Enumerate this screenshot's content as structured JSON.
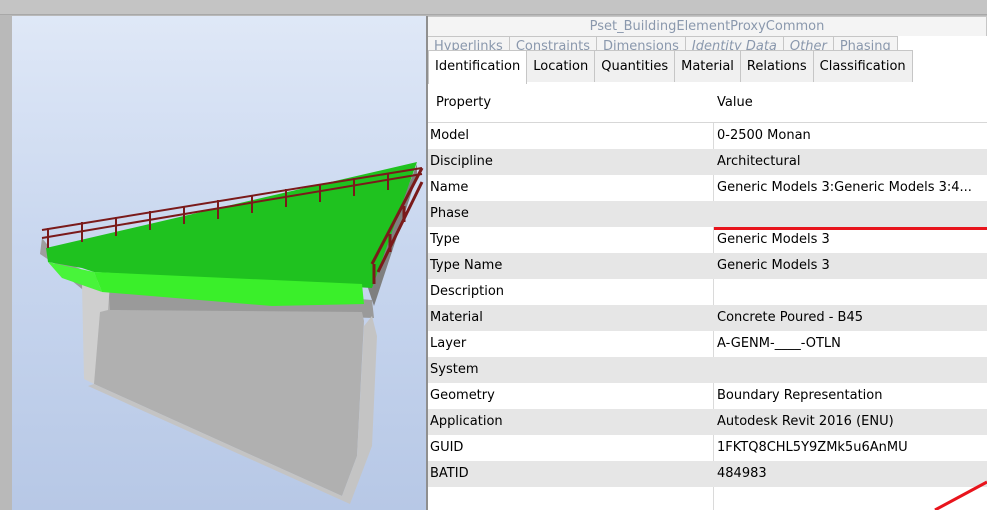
{
  "colors": {
    "accent_red": "#e8141c",
    "slab_green": "#1fc21f",
    "rail_maroon": "#7a1a1a"
  },
  "tabs": {
    "row_top": [
      "Pset_BuildingElementProxyCommon"
    ],
    "row_mid": [
      "Hyperlinks",
      "Constraints",
      "Dimensions",
      "Identity Data",
      "Other",
      "Phasing"
    ],
    "row_main": [
      "Identification",
      "Location",
      "Quantities",
      "Material",
      "Relations",
      "Classification"
    ],
    "active": "Identification"
  },
  "grid": {
    "headers": {
      "property": "Property",
      "value": "Value"
    },
    "rows": [
      {
        "property": "Model",
        "value": "0-2500 Monan"
      },
      {
        "property": "Discipline",
        "value": "Architectural"
      },
      {
        "property": "Name",
        "value": "Generic Models 3:Generic Models 3:4..."
      },
      {
        "property": "Phase",
        "value": ""
      },
      {
        "property": "Type",
        "value": "Generic Models 3"
      },
      {
        "property": "Type Name",
        "value": "Generic Models 3"
      },
      {
        "property": "Description",
        "value": ""
      },
      {
        "property": "Material",
        "value": "Concrete Poured - B45"
      },
      {
        "property": "Layer",
        "value": "A-GENM-____-OTLN"
      },
      {
        "property": "System",
        "value": ""
      },
      {
        "property": "Geometry",
        "value": "Boundary Representation"
      },
      {
        "property": "Application",
        "value": "Autodesk Revit 2016 (ENU)"
      },
      {
        "property": "GUID",
        "value": "1FKTQ8CHL5Y9ZMk5u6AnMU"
      },
      {
        "property": "BATID",
        "value": "484983"
      }
    ]
  }
}
